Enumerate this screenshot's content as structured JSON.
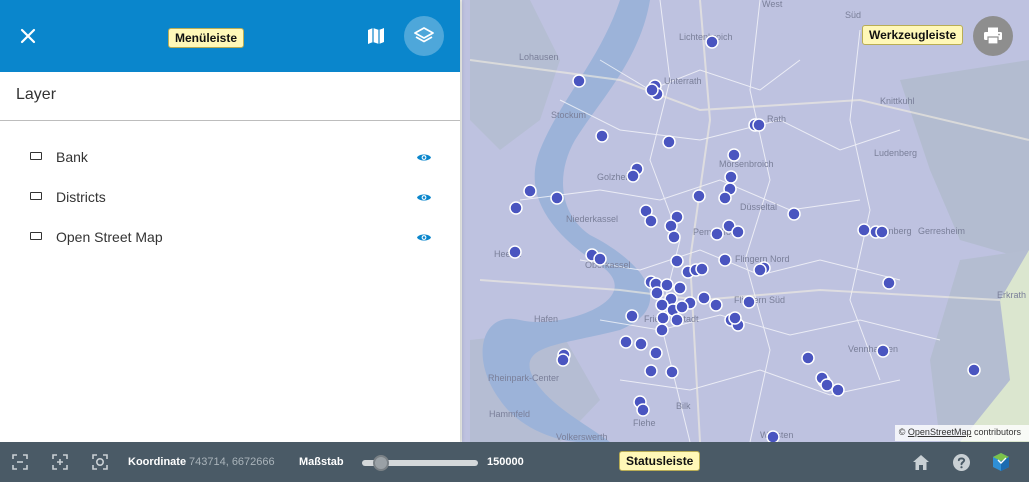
{
  "menubar": {
    "tag_label": "Menüleiste",
    "background": "#0a86cc",
    "buttons": [
      {
        "name": "close",
        "icon": "close-icon"
      },
      {
        "name": "map",
        "icon": "map-icon"
      },
      {
        "name": "layers",
        "icon": "layers-icon",
        "active": true
      }
    ]
  },
  "layer_panel": {
    "title": "Layer",
    "layers": [
      {
        "label": "Bank",
        "icon": "layer-rect-icon",
        "visibility_icon": "eye-icon",
        "visible": true
      },
      {
        "label": "Districts",
        "icon": "layer-rect-icon",
        "visibility_icon": "eye-icon",
        "visible": true
      },
      {
        "label": "Open Street Map",
        "icon": "layer-rect-icon",
        "visibility_icon": "eye-icon",
        "visible": true
      }
    ]
  },
  "toolbar": {
    "tag_label": "Werkzeugleiste",
    "print_icon": "printer-icon"
  },
  "map": {
    "place_labels": [
      "West",
      "Süd",
      "Lichtenbroich",
      "Unterrath",
      "Lohausen",
      "Stockum",
      "Rath",
      "Knittkuhl",
      "Mörsenbroich",
      "Ludenberg",
      "Golzheim",
      "Niederkassel",
      "Düsseltal",
      "Grafenberg",
      "Oberkassel",
      "Pempelfort",
      "Flingern Nord",
      "Flingern Süd",
      "Gerresheim",
      "Heerdt",
      "Hafen",
      "Friedrichstadt",
      "Erkrath",
      "Vennhausen",
      "Rheinpark-Center",
      "Hammfeld",
      "Volkerswerth",
      "Flehe",
      "Bilk",
      "Wersten"
    ],
    "overlay_color": "#8e94d4",
    "marker_color": "#4a55c0"
  },
  "attribution": {
    "prefix": "© ",
    "link": "OpenStreetMap",
    "suffix": " contributors"
  },
  "statusbar": {
    "tag_label": "Statusleiste",
    "left_icons": [
      "zoom-to-extent-icon",
      "zoom-in-box-icon",
      "zoom-recenter-icon"
    ],
    "coordinate_label": "Koordinate",
    "coordinate_value": "743714, 6672666",
    "scale_label": "Maßstab",
    "scale_value": "150000",
    "right_icons": [
      "home-icon",
      "help-icon",
      "app-logo-icon"
    ]
  }
}
